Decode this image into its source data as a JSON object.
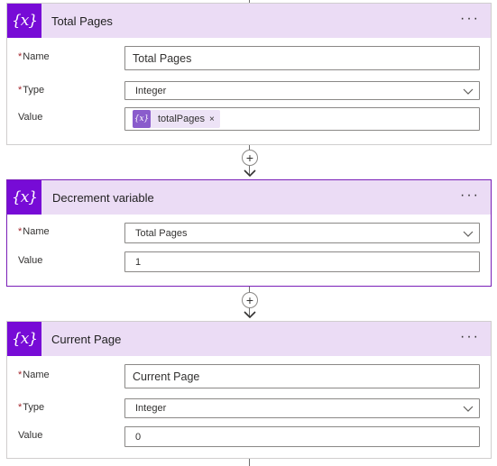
{
  "cards": [
    {
      "title": "Total Pages",
      "icon_text": "{x}",
      "icon": "variable-icon",
      "more": "···",
      "fields": {
        "name_label": "Name",
        "name_value": "Total Pages",
        "type_label": "Type",
        "type_value": "Integer",
        "value_label": "Value",
        "value_token": "totalPages",
        "token_icon_text": "{x}",
        "token_remove": "×"
      }
    },
    {
      "title": "Decrement variable",
      "icon_text": "{x}",
      "icon": "variable-icon",
      "more": "···",
      "fields": {
        "name_label": "Name",
        "name_value": "Total Pages",
        "value_label": "Value",
        "value_value": "1"
      }
    },
    {
      "title": "Current Page",
      "icon_text": "{x}",
      "icon": "variable-icon",
      "more": "···",
      "fields": {
        "name_label": "Name",
        "name_value": "Current Page",
        "type_label": "Type",
        "type_value": "Integer",
        "value_label": "Value",
        "value_value": "0"
      }
    }
  ],
  "required_mark": "*",
  "insert_step": "+",
  "colors": {
    "header_bg": "#ebdcf5",
    "icon_bg": "#770bd6",
    "selected_border": "#7a1fb8",
    "required": "#a4262c"
  }
}
